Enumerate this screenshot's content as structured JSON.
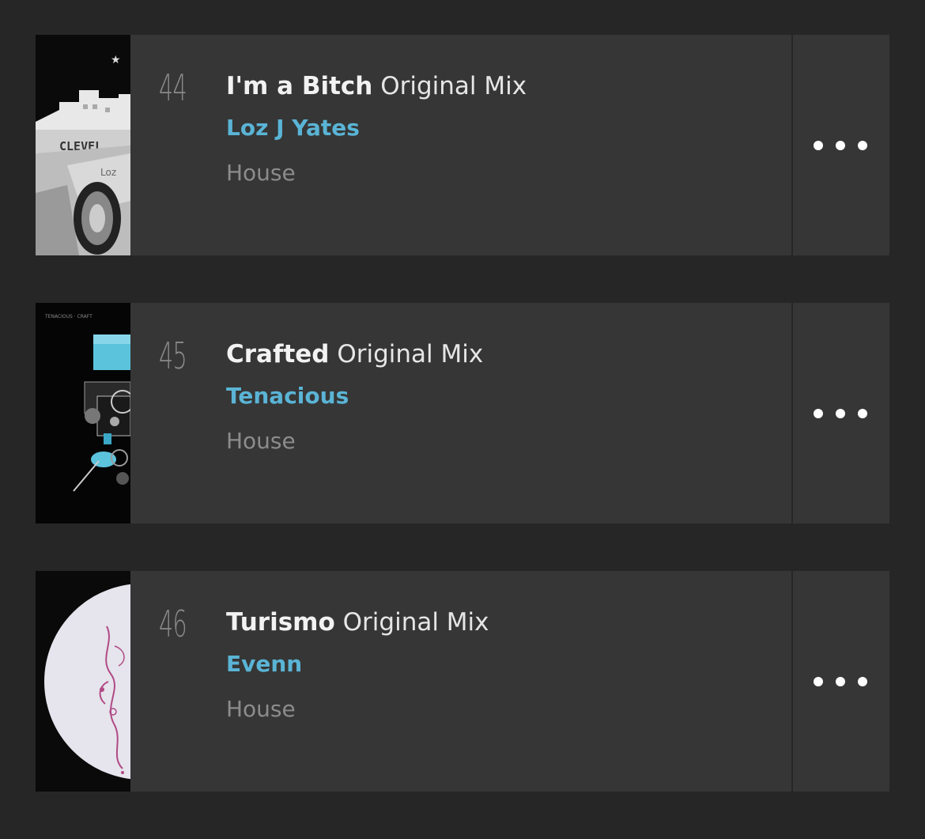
{
  "tracks": [
    {
      "number": "44",
      "title": "I'm a Bitch",
      "mix": "Original Mix",
      "artist": "Loz J Yates",
      "genre": "House",
      "artwork_text": "CLEVEL",
      "artwork_subtext": "Loz"
    },
    {
      "number": "45",
      "title": "Crafted",
      "mix": "Original Mix",
      "artist": "Tenacious",
      "genre": "House",
      "artwork_text": "TENACIOUS · CRAFT"
    },
    {
      "number": "46",
      "title": "Turismo",
      "mix": "Original Mix",
      "artist": "Evenn",
      "genre": "House"
    }
  ],
  "colors": {
    "background": "#262626",
    "row": "#363636",
    "artist": "#5ab4d6",
    "genre": "#8c8c8c",
    "number": "#8a8a8a"
  },
  "icons": {
    "more": "ellipsis-horizontal-icon"
  }
}
